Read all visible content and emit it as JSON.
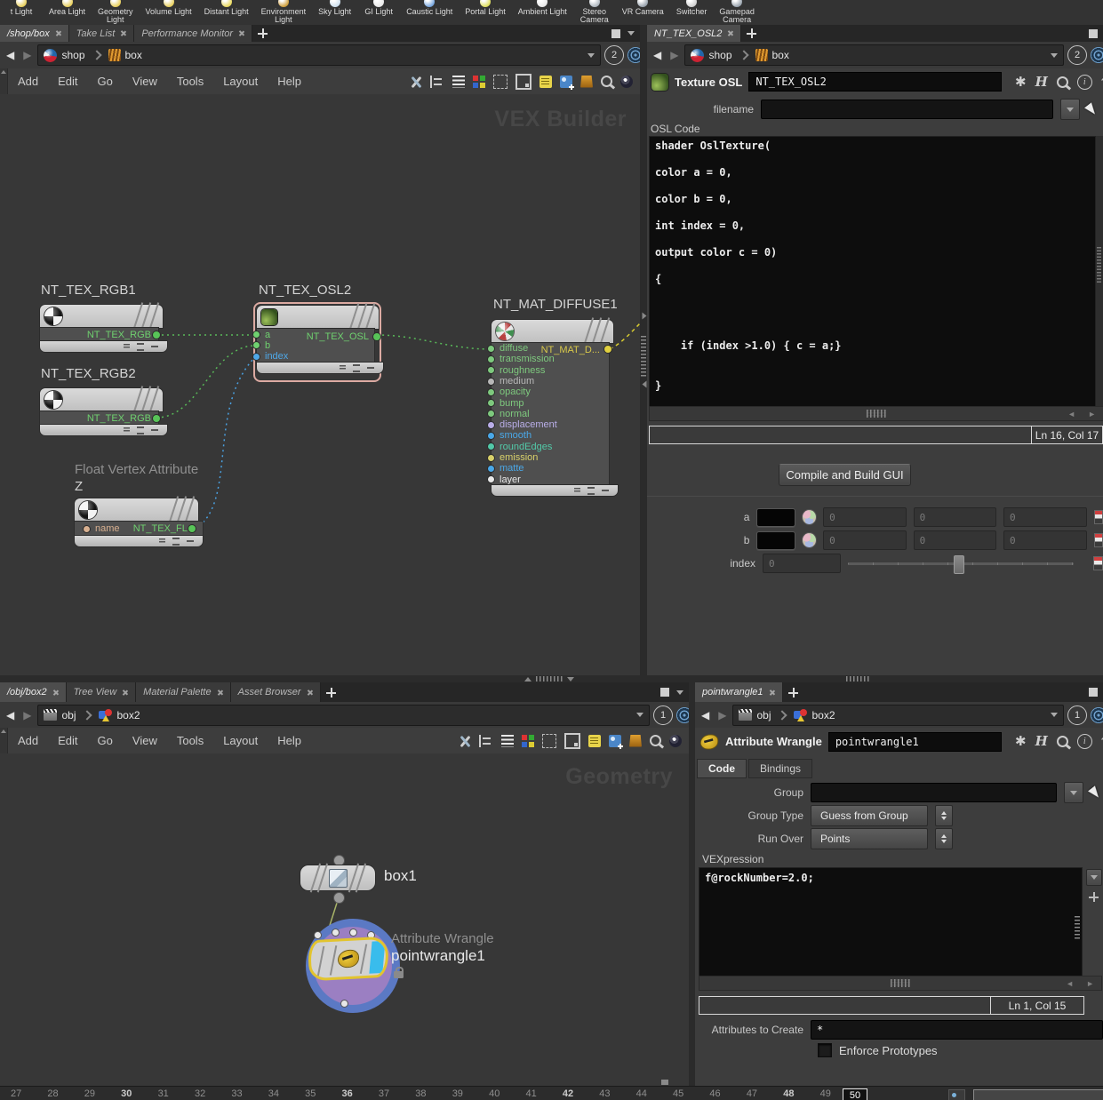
{
  "shelf": {
    "tools": [
      {
        "label": "t Light",
        "color": "#e8d060"
      },
      {
        "label": "Area Light",
        "color": "#e8d060"
      },
      {
        "label": "Geometry\nLight",
        "color": "#e8d060"
      },
      {
        "label": "Volume Light",
        "color": "#e8d060"
      },
      {
        "label": "Distant Light",
        "color": "#e8d860"
      },
      {
        "label": "Environment\nLight",
        "color": "#cfa040"
      },
      {
        "label": "Sky Light",
        "color": "#cfe0ef"
      },
      {
        "label": "GI Light",
        "color": "#e8e8e8"
      },
      {
        "label": "Caustic Light",
        "color": "#7aa8e0"
      },
      {
        "label": "Portal Light",
        "color": "#e0e060"
      },
      {
        "label": "Ambient Light",
        "color": "#e8e8e8"
      },
      {
        "label": "Stereo\nCamera",
        "color": "#b0b8c0"
      },
      {
        "label": "VR Camera",
        "color": "#9aa4ae"
      },
      {
        "label": "Switcher",
        "color": "#cfcfcf"
      },
      {
        "label": "Gamepad\nCamera",
        "color": "#9aa4ae"
      }
    ]
  },
  "top_left": {
    "tabs": [
      {
        "label": "/shop/box",
        "cls": "active"
      },
      {
        "label": "Take List",
        "cls": ""
      },
      {
        "label": "Performance Monitor",
        "cls": ""
      }
    ],
    "path": {
      "root": "shop",
      "node": "box",
      "count": "2"
    },
    "menus": [
      {
        "label": "Add"
      },
      {
        "label": "Edit"
      },
      {
        "label": "Go"
      },
      {
        "label": "View"
      },
      {
        "label": "Tools"
      },
      {
        "label": "Layout"
      },
      {
        "label": "Help"
      }
    ],
    "watermark": "VEX Builder",
    "nodes": {
      "rgb1": {
        "title": "NT_TEX_RGB1",
        "output": "NT_TEX_RGB"
      },
      "rgb2": {
        "title": "NT_TEX_RGB2",
        "output": "NT_TEX_RGB"
      },
      "osl2": {
        "title": "NT_TEX_OSL2",
        "output": "NT_TEX_OSL",
        "inputs": [
          {
            "label": "a",
            "color": "#6fd06f"
          },
          {
            "label": "b",
            "color": "#6fd06f"
          },
          {
            "label": "index",
            "color": "#4fa8e8"
          }
        ]
      },
      "mat": {
        "title": "NT_MAT_DIFFUSE1",
        "output": "NT_MAT_D...",
        "inputs": [
          {
            "label": "diffuse",
            "color": "#7ec97e"
          },
          {
            "label": "transmission",
            "color": "#7ec97e"
          },
          {
            "label": "roughness",
            "color": "#7ec97e"
          },
          {
            "label": "medium",
            "color": "#b8b8b8"
          },
          {
            "label": "opacity",
            "color": "#7ec97e"
          },
          {
            "label": "bump",
            "color": "#7ec97e"
          },
          {
            "label": "normal",
            "color": "#7ec97e"
          },
          {
            "label": "displacement",
            "color": "#b9aee8"
          },
          {
            "label": "smooth",
            "color": "#4aa8e8"
          },
          {
            "label": "roundEdges",
            "color": "#52c9a8"
          },
          {
            "label": "emission",
            "color": "#d8d06a"
          },
          {
            "label": "matte",
            "color": "#4aa8e8"
          },
          {
            "label": "layer",
            "color": "#e8e8e8"
          }
        ]
      },
      "floatattr": {
        "title": "Float Vertex Attribute",
        "subtitle": "Z",
        "input": "name",
        "output": "NT_TEX_FL..."
      }
    }
  },
  "top_right": {
    "tab": "NT_TEX_OSL2",
    "path": {
      "root": "shop",
      "node": "box",
      "count": "2"
    },
    "header": {
      "type": "Texture OSL",
      "name": "NT_TEX_OSL2"
    },
    "filename_label": "filename",
    "code_label": "OSL Code",
    "code_lines": [
      {
        "t": "shader OslTexture("
      },
      {
        "t": ""
      },
      {
        "t": "color a = 0,"
      },
      {
        "t": ""
      },
      {
        "t": "color b = 0,"
      },
      {
        "t": ""
      },
      {
        "t": "int index = 0,"
      },
      {
        "t": ""
      },
      {
        "t": "output color c = 0)"
      },
      {
        "t": ""
      },
      {
        "t": "{"
      },
      {
        "t": ""
      },
      {
        "t": ""
      },
      {
        "t": ""
      },
      {
        "t": ""
      },
      {
        "t": "    if (index >1.0) { c = a;}"
      },
      {
        "t": ""
      },
      {
        "t": ""
      },
      {
        "t": "}"
      }
    ],
    "status": "Ln 16, Col 17",
    "compile_button": "Compile and Build GUI",
    "param_a": "a",
    "param_b": "b",
    "param_index": "index",
    "zero": "0"
  },
  "bottom_left": {
    "tabs": [
      {
        "label": "/obj/box2",
        "cls": "active"
      },
      {
        "label": "Tree View",
        "cls": ""
      },
      {
        "label": "Material Palette",
        "cls": ""
      },
      {
        "label": "Asset Browser",
        "cls": ""
      }
    ],
    "path": {
      "root": "obj",
      "node": "box2",
      "count": "1"
    },
    "menus": [
      {
        "label": "Add"
      },
      {
        "label": "Edit"
      },
      {
        "label": "Go"
      },
      {
        "label": "View"
      },
      {
        "label": "Tools"
      },
      {
        "label": "Layout"
      },
      {
        "label": "Help"
      }
    ],
    "watermark": "Geometry",
    "nodes": {
      "box1": {
        "label": "box1"
      },
      "wrangle": {
        "type_label": "Attribute Wrangle",
        "name": "pointwrangle1"
      }
    }
  },
  "bottom_right": {
    "tab": "pointwrangle1",
    "path": {
      "root": "obj",
      "node": "box2",
      "count": "1"
    },
    "header": {
      "type": "Attribute Wrangle",
      "name": "pointwrangle1"
    },
    "tabs": [
      {
        "label": "Code",
        "cls": "active"
      },
      {
        "label": "Bindings",
        "cls": ""
      }
    ],
    "group_label": "Group",
    "group_type_label": "Group Type",
    "group_type_value": "Guess from Group",
    "run_over_label": "Run Over",
    "run_over_value": "Points",
    "vex_label": "VEXpression",
    "vex_code": "f@rockNumber=2.0;",
    "status": "Ln 1, Col 15",
    "attributes_label": "Attributes to Create",
    "attributes_value": "*",
    "enforce_label": "Enforce Prototypes"
  },
  "timeline": {
    "frames": [
      {
        "n": "27",
        "cls": ""
      },
      {
        "n": "28",
        "cls": ""
      },
      {
        "n": "29",
        "cls": ""
      },
      {
        "n": "30",
        "cls": "strong"
      },
      {
        "n": "31",
        "cls": ""
      },
      {
        "n": "32",
        "cls": ""
      },
      {
        "n": "33",
        "cls": ""
      },
      {
        "n": "34",
        "cls": ""
      },
      {
        "n": "35",
        "cls": ""
      },
      {
        "n": "36",
        "cls": "strong"
      },
      {
        "n": "37",
        "cls": ""
      },
      {
        "n": "38",
        "cls": ""
      },
      {
        "n": "39",
        "cls": ""
      },
      {
        "n": "40",
        "cls": ""
      },
      {
        "n": "41",
        "cls": ""
      },
      {
        "n": "42",
        "cls": "strong"
      },
      {
        "n": "43",
        "cls": ""
      },
      {
        "n": "44",
        "cls": ""
      },
      {
        "n": "45",
        "cls": ""
      },
      {
        "n": "46",
        "cls": ""
      },
      {
        "n": "47",
        "cls": ""
      },
      {
        "n": "48",
        "cls": "strong"
      },
      {
        "n": "49",
        "cls": ""
      }
    ],
    "current": "50"
  }
}
